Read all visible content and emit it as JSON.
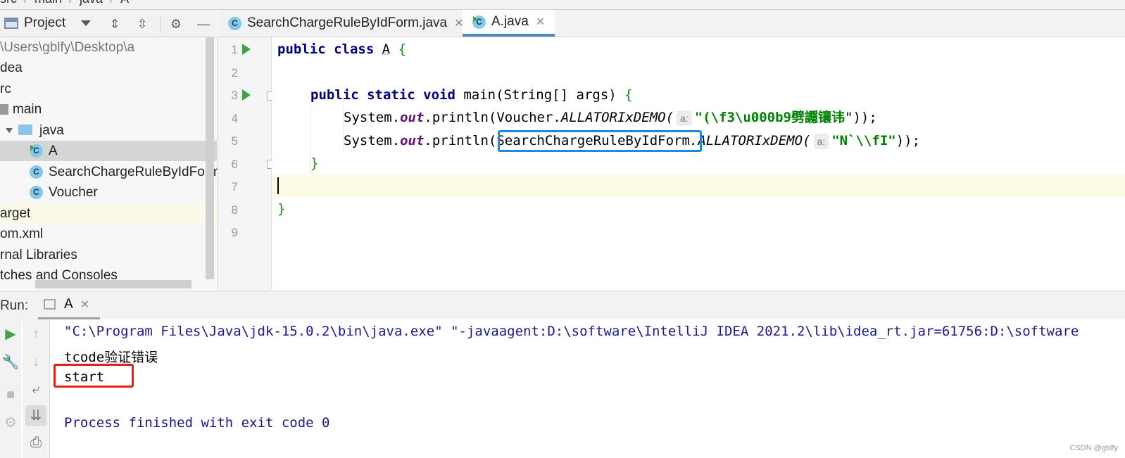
{
  "breadcrumb": {
    "items": [
      "src",
      "main",
      "java",
      "A"
    ]
  },
  "project_panel": {
    "title": "Project",
    "tree": [
      {
        "label": "\\Users\\gblfy\\Desktop\\a",
        "kind": "path"
      },
      {
        "label": "dea",
        "kind": "folder"
      },
      {
        "label": "rc",
        "kind": "folder"
      },
      {
        "label": "main",
        "kind": "folder"
      },
      {
        "label": "java",
        "kind": "source-folder"
      },
      {
        "label": "A",
        "kind": "class",
        "selected": true
      },
      {
        "label": "SearchChargeRuleByIdForm",
        "kind": "class"
      },
      {
        "label": "Voucher",
        "kind": "class"
      },
      {
        "label": "arget",
        "kind": "folder"
      },
      {
        "label": "om.xml",
        "kind": "file"
      },
      {
        "label": "rnal Libraries",
        "kind": "libraries"
      },
      {
        "label": "tches and Consoles",
        "kind": "consoles"
      }
    ]
  },
  "editor": {
    "tabs": [
      {
        "label": "SearchChargeRuleByIdForm.java",
        "active": false
      },
      {
        "label": "A.java",
        "active": true
      }
    ],
    "line_numbers": [
      "1",
      "2",
      "3",
      "4",
      "5",
      "6",
      "7",
      "8",
      "9"
    ],
    "code": {
      "l1_kw": "public class",
      "l1_name": "A",
      "l1_brace": "{",
      "l3_kw": "public static void",
      "l3_sig": "main(String[] args)",
      "l3_brace": "{",
      "l4_prefix": "System.",
      "l4_out": "out",
      "l4_println": ".println(Voucher.",
      "l4_method": "ALLATORIxDEMO(",
      "l4_hint": "a:",
      "l4_str": "\"(\\f3\\u000b9",
      "l4_cjk": "劈讔镶讳",
      "l4_end": "\"));",
      "l5_prefix": "System.",
      "l5_out": "out",
      "l5_println": ".println(",
      "l5_class": "SearchChargeRuleByIdForm",
      "l5_method": ".ALLATORIxDEMO(",
      "l5_hint": "a:",
      "l5_str": "\"N`\\\\fI\"",
      "l5_end": "));",
      "l6_brace": "}",
      "l8_brace": "}"
    }
  },
  "run_panel": {
    "label": "Run:",
    "tab": "A",
    "output": [
      "\"C:\\Program Files\\Java\\jdk-15.0.2\\bin\\java.exe\" \"-javaagent:D:\\software\\IntelliJ IDEA 2021.2\\lib\\idea_rt.jar=61756:D:\\software",
      "tcode验证错误",
      "start",
      "",
      "Process finished with exit code 0"
    ]
  },
  "watermark": "CSDN @gblfy"
}
